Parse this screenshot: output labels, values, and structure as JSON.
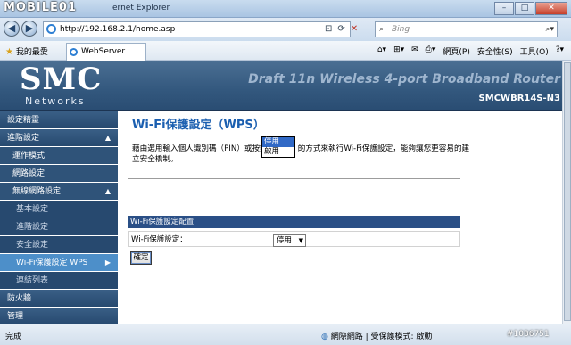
{
  "browser": {
    "watermark": "MOBILE01",
    "window_title": "ernet Explorer",
    "url": "http://192.168.2.1/home.asp",
    "search_placeholder": "Bing",
    "favorites_label": "我的最愛",
    "tab_title": "WebServer",
    "tools": [
      "網頁(P)",
      "安全性(S)",
      "工具(O)"
    ],
    "status_left": "完成",
    "status_zone": "網際網路 | 受保護模式: 啟動",
    "photo_id": "#1036751"
  },
  "header": {
    "logo": "SMC",
    "logo_sub": "Networks",
    "product": "Draft 11n Wireless 4-port Broadband Router",
    "model": "SMCWBR14S-N3"
  },
  "sidebar": {
    "items": [
      {
        "label": "設定精靈"
      },
      {
        "label": "進階設定"
      },
      {
        "label": "運作模式"
      },
      {
        "label": "網路設定"
      },
      {
        "label": "無線網路設定"
      },
      {
        "label": "基本設定"
      },
      {
        "label": "進階設定"
      },
      {
        "label": "安全設定"
      },
      {
        "label": "Wi-Fi保護設定 WPS"
      },
      {
        "label": "連結列表"
      },
      {
        "label": "防火牆"
      },
      {
        "label": "管理"
      }
    ]
  },
  "main": {
    "title": "Wi-Fi保護設定（WPS）",
    "description": "藉由選用輸入個人識別碼（PIN）或按鈕（PBC）的方式來執行Wi-Fi保護設定，能夠讓您更容易的建立安全橋制。",
    "section_header": "Wi-Fi保護設定配置",
    "field_label": "Wi-Fi保護設定：",
    "select_value": "停用",
    "options": [
      "停用",
      "啟用"
    ],
    "confirm_button": "確定"
  }
}
